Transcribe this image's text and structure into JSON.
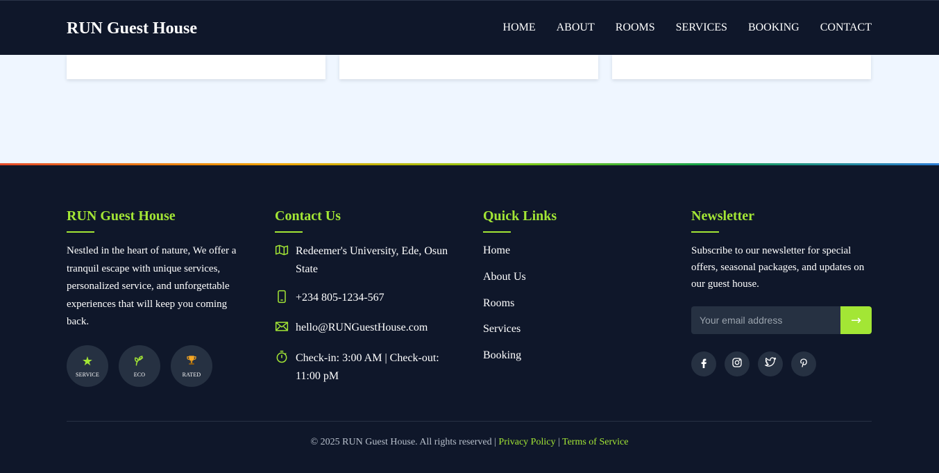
{
  "header": {
    "brand": "RUN Guest House",
    "nav": [
      "HOME",
      "ABOUT",
      "ROOMS",
      "SERVICES",
      "BOOKING",
      "CONTACT"
    ]
  },
  "footer": {
    "about": {
      "title": "RUN Guest House",
      "text": "Nestled in the heart of nature, We offer a tranquil escape with unique services, personalized service, and unforgettable experiences that will keep you coming back.",
      "badges": [
        {
          "icon": "star-icon",
          "label": "SERVICE"
        },
        {
          "icon": "leaf-icon",
          "label": "ECO"
        },
        {
          "icon": "trophy-icon",
          "label": "RATED"
        }
      ]
    },
    "contact": {
      "title": "Contact Us",
      "address": "Redeemer's University, Ede, Osun State",
      "phone": "+234 805-1234-567",
      "email": "hello@RUNGuestHouse.com",
      "hours": "Check-in: 3:00 AM | Check-out: 11:00 pM"
    },
    "quick_links": {
      "title": "Quick Links",
      "items": [
        "Home",
        "About Us",
        "Rooms",
        "Services",
        "Booking"
      ]
    },
    "newsletter": {
      "title": "Newsletter",
      "text": "Subscribe to our newsletter for special offers, seasonal packages, and updates on our guest house.",
      "placeholder": "Your email address",
      "button": "→",
      "socials": [
        "facebook-icon",
        "instagram-icon",
        "twitter-icon",
        "pinterest-icon"
      ]
    },
    "copyright": "© 2025 RUN Guest House. All rights reserved |",
    "privacy": "Privacy Policy",
    "separator": "|",
    "terms": "Terms of Service"
  },
  "colors": {
    "accent": "#a3e635",
    "background": "#0f172a",
    "light_section": "#eff6ff"
  }
}
